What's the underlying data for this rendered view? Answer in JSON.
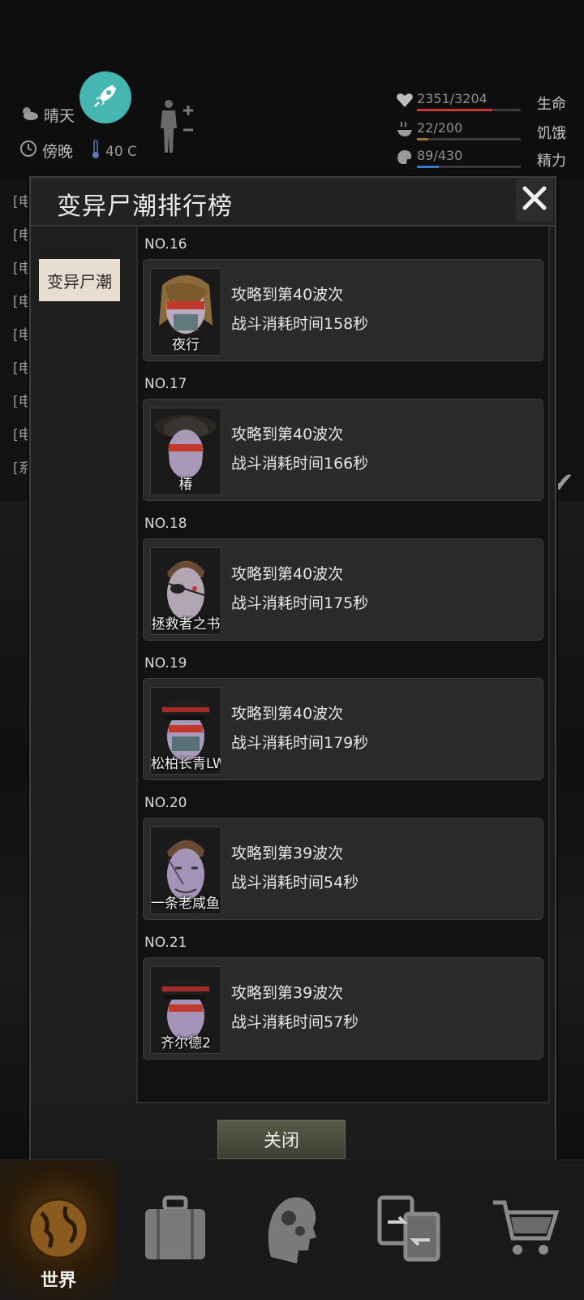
{
  "status": {
    "weather": "晴天",
    "time_of_day": "傍晚",
    "temperature": "40 C",
    "life": {
      "value": "2351/3204",
      "label": "生命",
      "fraction": 0.73,
      "color": "#c43a3a"
    },
    "hunger": {
      "value": "22/200",
      "label": "饥饿",
      "fraction": 0.11,
      "color": "#9a7a3a"
    },
    "energy": {
      "value": "89/430",
      "label": "精力",
      "fraction": 0.21,
      "color": "#3a7ac4"
    }
  },
  "chat_prefixes": [
    "[电",
    "[电",
    "[电",
    "[电",
    "[电",
    "[电",
    "[电",
    "[电",
    "[系"
  ],
  "modal": {
    "title": "变异尸潮排行榜",
    "tab": "变异尸潮",
    "close_button": "关闭",
    "entries": [
      {
        "rank": "NO.16",
        "name": "夜行",
        "wave": "攻略到第40波次",
        "time": "战斗消耗时间158秒",
        "face": "#b7aabc",
        "hair": "#8a6a3a"
      },
      {
        "rank": "NO.17",
        "name": "椿",
        "wave": "攻略到第40波次",
        "time": "战斗消耗时间166秒",
        "face": "#a998b6",
        "hair": "#2a2622"
      },
      {
        "rank": "NO.18",
        "name": "拯救者之书",
        "wave": "攻略到第40波次",
        "time": "战斗消耗时间175秒",
        "face": "#b3a6b3",
        "hair": "#6a4a34"
      },
      {
        "rank": "NO.19",
        "name": "松柏长青LWB",
        "wave": "攻略到第40波次",
        "time": "战斗消耗时间179秒",
        "face": "#a89ab8",
        "hair": "#1e1e1e"
      },
      {
        "rank": "NO.20",
        "name": "一条老咸鱼干",
        "wave": "攻略到第39波次",
        "time": "战斗消耗时间54秒",
        "face": "#a494b8",
        "hair": "#6a4a34"
      },
      {
        "rank": "NO.21",
        "name": "齐尔德2",
        "wave": "攻略到第39波次",
        "time": "战斗消耗时间57秒",
        "face": "#a494b8",
        "hair": "#1e1e1e"
      }
    ]
  },
  "nav": {
    "world_label": "世界",
    "icons": [
      "globe-icon",
      "backpack-icon",
      "head-gears-icon",
      "exchange-icon",
      "cart-icon"
    ]
  }
}
